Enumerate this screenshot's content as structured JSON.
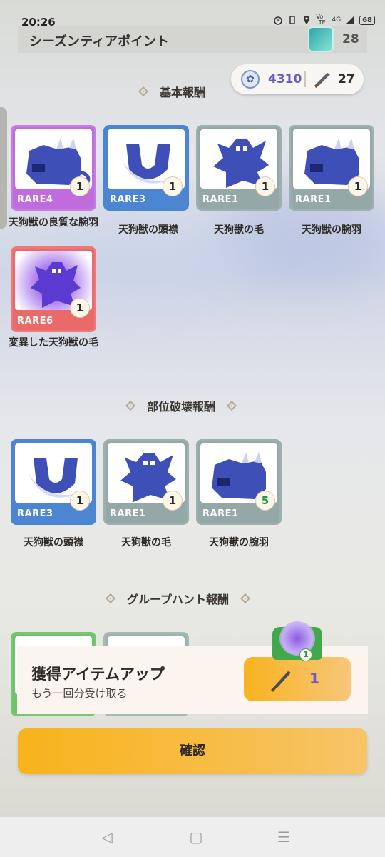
{
  "status_bar": {
    "time": "20:26",
    "network": "4G",
    "volte": "Vo LTE",
    "battery": "68"
  },
  "season_bar": {
    "label": "シーズンティアポイント",
    "value": "28"
  },
  "currency": {
    "paw_value": "4310",
    "knife_value": "27"
  },
  "sections": {
    "basic": {
      "title": "基本報酬",
      "items": [
        {
          "rare": "RARE4",
          "qty": "1",
          "name": "天狗獣の良質な腕羽"
        },
        {
          "rare": "RARE3",
          "qty": "1",
          "name": "天狗獣の頭襟"
        },
        {
          "rare": "RARE1",
          "qty": "1",
          "name": "天狗獣の毛"
        },
        {
          "rare": "RARE1",
          "qty": "1",
          "name": "天狗獣の腕羽"
        },
        {
          "rare": "RARE6",
          "qty": "1",
          "name": "変異した天狗獣の毛"
        }
      ]
    },
    "part_break": {
      "title": "部位破壊報酬",
      "items": [
        {
          "rare": "RARE3",
          "qty": "1",
          "name": "天狗獣の頭襟"
        },
        {
          "rare": "RARE1",
          "qty": "1",
          "name": "天狗獣の毛"
        },
        {
          "rare": "RARE1",
          "qty": "5",
          "name": "天狗獣の腕羽"
        }
      ]
    },
    "group_hunt": {
      "title": "グループハント報酬"
    }
  },
  "bonus_panel": {
    "title": "獲得アイテムアップ",
    "subtitle": "もう一回分受け取る",
    "button_count": "1",
    "floating_qty": "1"
  },
  "confirm_button": "確認",
  "colors": {
    "rare1": "#94a8a8",
    "rare3": "#4c86d2",
    "rare4": "#c06cdc",
    "rare6": "#ea6a6a",
    "accent_orange": "#f8b31f",
    "accent_purple": "#6a5ac5"
  },
  "icons": [
    "alarm-icon",
    "vibrate-icon",
    "location-icon",
    "signal-icon",
    "paw-icon",
    "knife-icon",
    "back-icon",
    "home-icon",
    "menu-icon"
  ]
}
